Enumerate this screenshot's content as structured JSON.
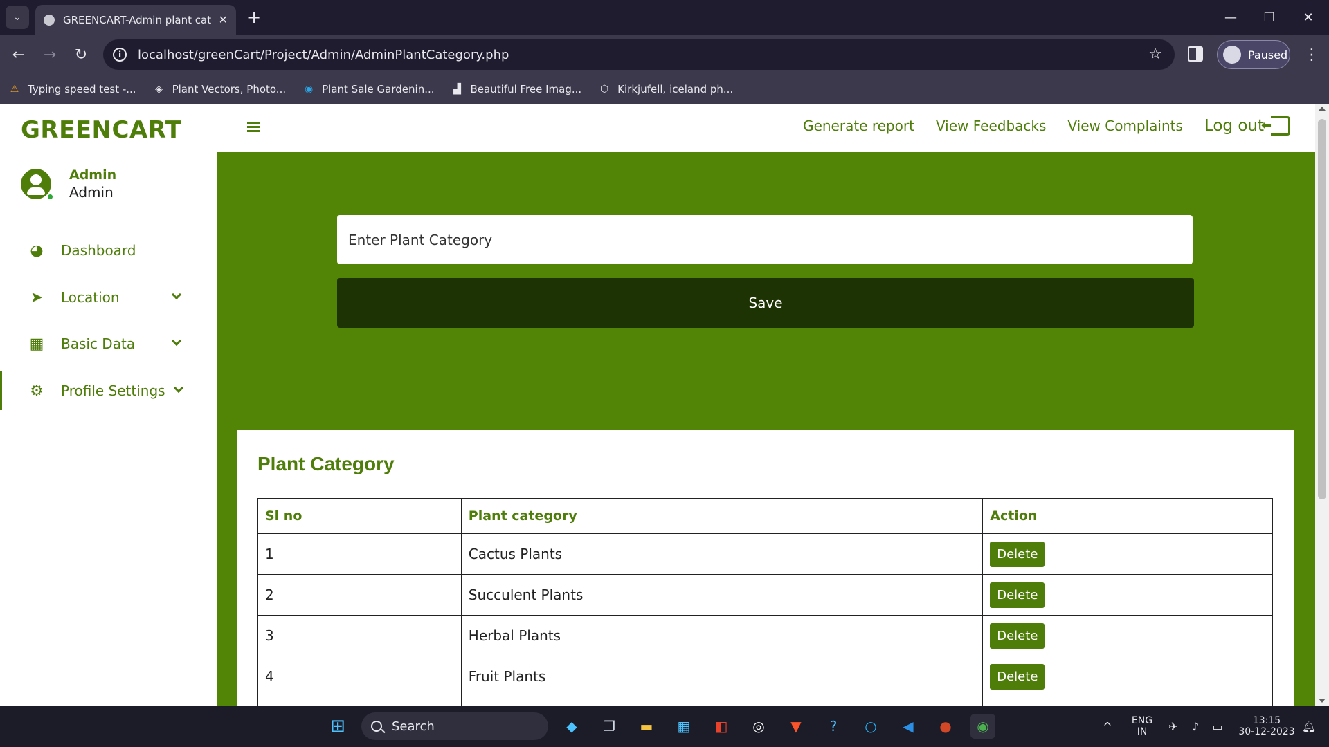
{
  "browser": {
    "tab_title": "GREENCART-Admin plant categ",
    "url": "localhost/greenCart/Project/Admin/AdminPlantCategory.php",
    "profile_label": "Paused",
    "bookmarks": [
      {
        "label": "Typing speed test -...",
        "icon": "warning-icon"
      },
      {
        "label": "Plant Vectors, Photo...",
        "icon": "freepik-icon"
      },
      {
        "label": "Plant Sale Gardenin...",
        "icon": "search-globe-icon"
      },
      {
        "label": "Beautiful Free Imag...",
        "icon": "unsplash-icon"
      },
      {
        "label": "Kirkjufell, iceland ph...",
        "icon": "cube-icon"
      }
    ]
  },
  "app": {
    "brand": "GREENCART",
    "user": {
      "name": "Admin",
      "role": "Admin"
    },
    "nav": [
      {
        "label": "Dashboard",
        "icon": "dashboard-icon"
      },
      {
        "label": "Location",
        "icon": "location-arrow-icon"
      },
      {
        "label": "Basic Data",
        "icon": "grid-icon"
      },
      {
        "label": "Profile Settings",
        "icon": "gears-icon"
      }
    ],
    "topnav": {
      "generate_report": "Generate report",
      "view_feedbacks": "View Feedbacks",
      "view_complaints": "View Complaints",
      "logout": "Log out"
    },
    "form": {
      "category_placeholder": "Enter Plant Category",
      "save_label": "Save"
    },
    "table": {
      "title": "Plant Category",
      "headers": [
        "Sl no",
        "Plant category",
        "Action"
      ],
      "rows": [
        {
          "sl": "1",
          "category": "Cactus Plants",
          "action": "Delete"
        },
        {
          "sl": "2",
          "category": "Succulent Plants",
          "action": "Delete"
        },
        {
          "sl": "3",
          "category": "Herbal Plants",
          "action": "Delete"
        },
        {
          "sl": "4",
          "category": "Fruit Plants",
          "action": "Delete"
        }
      ]
    },
    "colors": {
      "primary": "#528405",
      "dark_button": "#1e3303",
      "text_green": "#4e7d09"
    }
  },
  "taskbar": {
    "search_label": "Search",
    "lang": "ENG",
    "region": "IN",
    "time": "13:15",
    "date": "30-12-2023"
  }
}
